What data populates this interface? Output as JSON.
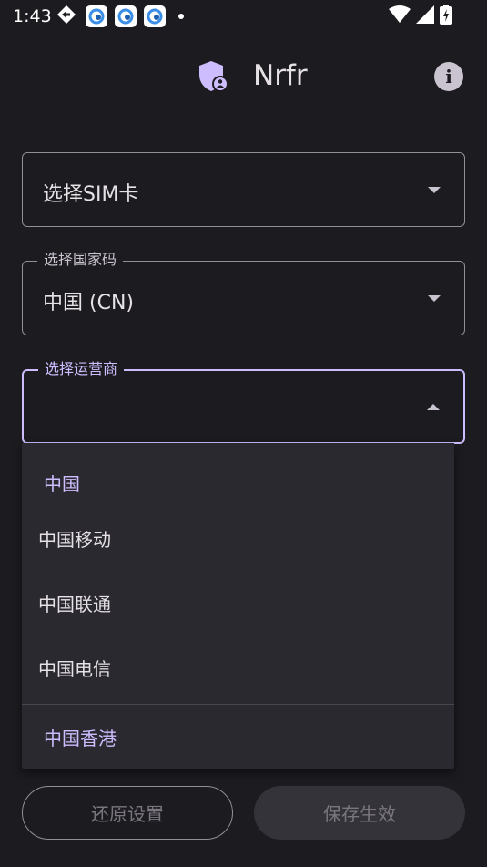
{
  "status_bar": {
    "time": "1:43",
    "notification_icons": [
      "nav-diamond-icon",
      "app-notification-icon",
      "app-notification-icon",
      "app-notification-icon",
      "dot-icon"
    ],
    "system_icons": [
      "wifi-icon",
      "signal-icon",
      "battery-charging-icon"
    ]
  },
  "app_bar": {
    "title": "Nrfr",
    "logo_icon": "shield-person-icon",
    "info_icon": "info-icon"
  },
  "form": {
    "sim_select": {
      "placeholder": "选择SIM卡"
    },
    "country_select": {
      "label": "选择国家码",
      "value": "中国 (CN)"
    },
    "carrier_select": {
      "label": "选择运营商",
      "value": ""
    }
  },
  "dropdown": {
    "group_header": "中国",
    "items": [
      "中国移动",
      "中国联通",
      "中国电信"
    ],
    "next_group_header": "中国香港"
  },
  "buttons": {
    "reset": "还原设置",
    "save": "保存生效"
  },
  "colors": {
    "background": "#1c1b1f",
    "accent": "#cdbdfe",
    "outline": "#938f99",
    "menu_surface": "#2b2930",
    "disabled_text": "#7a767f"
  }
}
